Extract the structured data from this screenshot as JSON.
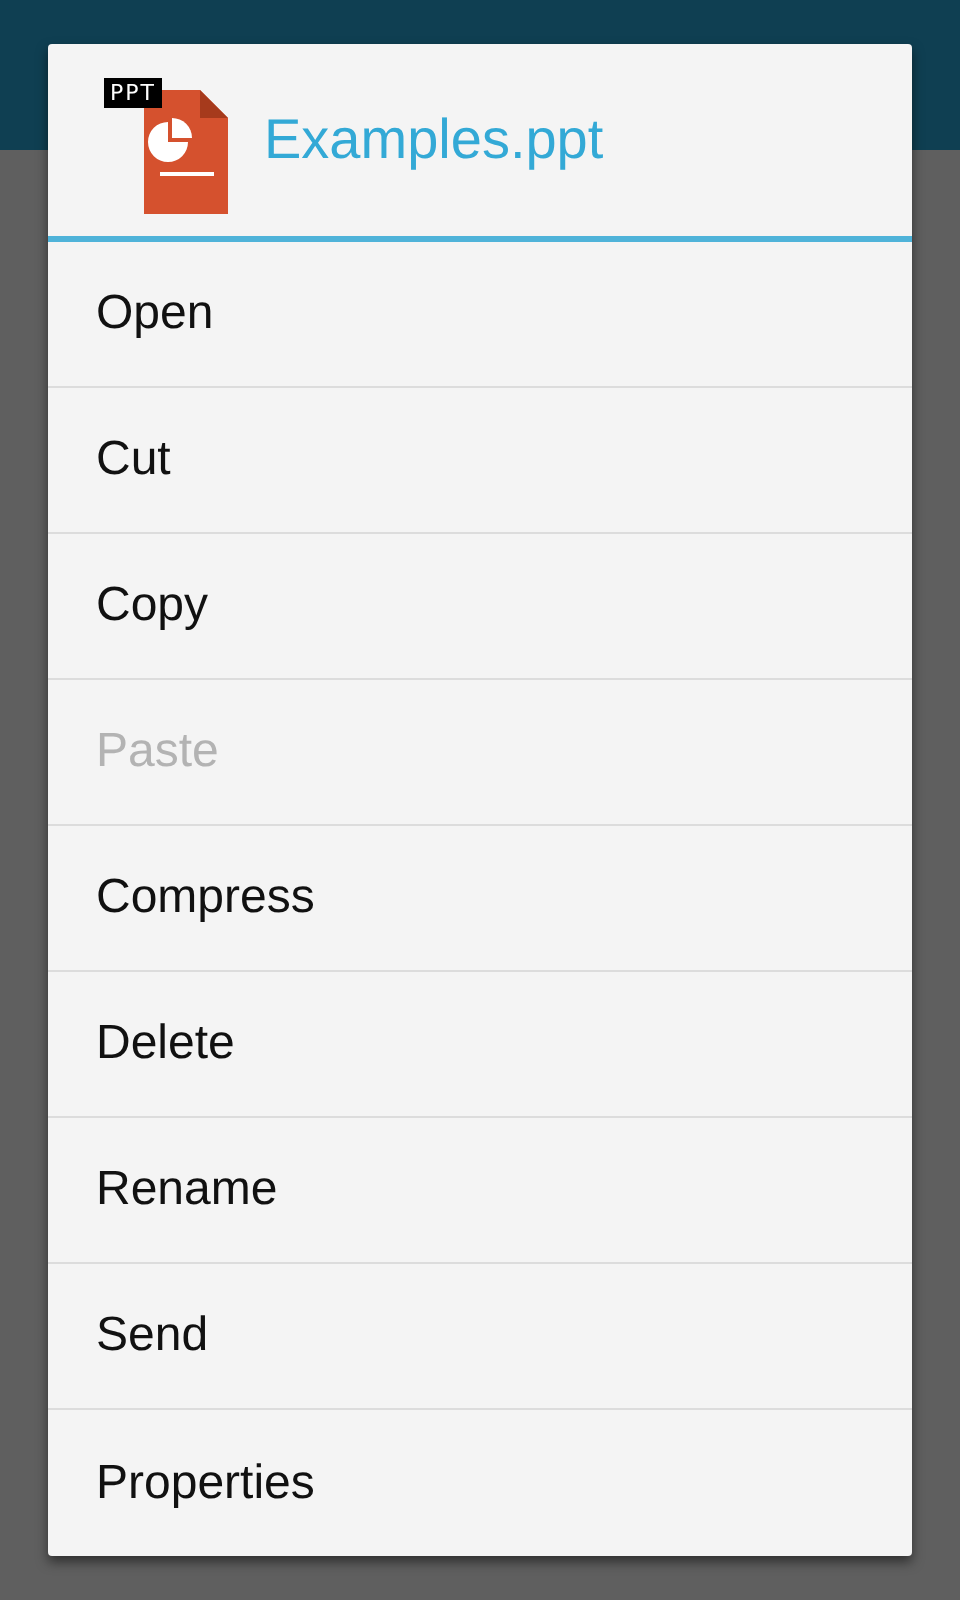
{
  "dialog": {
    "file_icon_label": "PPT",
    "title": "Examples.ppt"
  },
  "menu": [
    {
      "label": "Open",
      "disabled": false
    },
    {
      "label": "Cut",
      "disabled": false
    },
    {
      "label": "Copy",
      "disabled": false
    },
    {
      "label": "Paste",
      "disabled": true
    },
    {
      "label": "Compress",
      "disabled": false
    },
    {
      "label": "Delete",
      "disabled": false
    },
    {
      "label": "Rename",
      "disabled": false
    },
    {
      "label": "Send",
      "disabled": false
    },
    {
      "label": "Properties",
      "disabled": false
    }
  ]
}
